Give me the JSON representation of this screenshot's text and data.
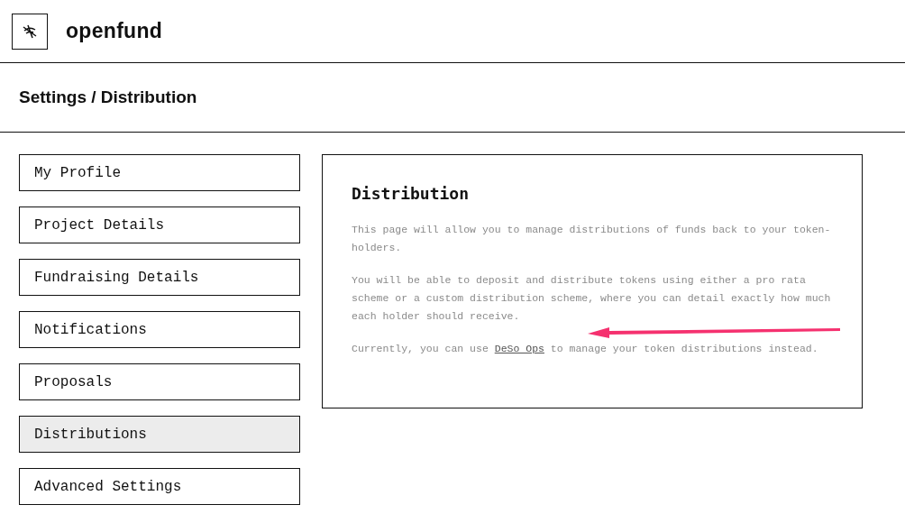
{
  "brand": {
    "name": "openfund"
  },
  "breadcrumb": "Settings / Distribution",
  "sidebar": {
    "items": [
      {
        "label": "My Profile",
        "selected": false
      },
      {
        "label": "Project Details",
        "selected": false
      },
      {
        "label": "Fundraising Details",
        "selected": false
      },
      {
        "label": "Notifications",
        "selected": false
      },
      {
        "label": "Proposals",
        "selected": false
      },
      {
        "label": "Distributions",
        "selected": true
      },
      {
        "label": "Advanced Settings",
        "selected": false
      }
    ]
  },
  "panel": {
    "title": "Distribution",
    "paragraphs": [
      {
        "kind": "text",
        "text": "This page will allow you to manage distributions of funds back to your token-holders."
      },
      {
        "kind": "text",
        "text": "You will be able to deposit and distribute tokens using either a pro rata scheme or a custom distribution scheme, where you can detail exactly how much each holder should receive."
      },
      {
        "kind": "link",
        "before": "Currently, you can use ",
        "link": "DeSo Ops",
        "after": " to manage your token distributions instead."
      }
    ]
  }
}
